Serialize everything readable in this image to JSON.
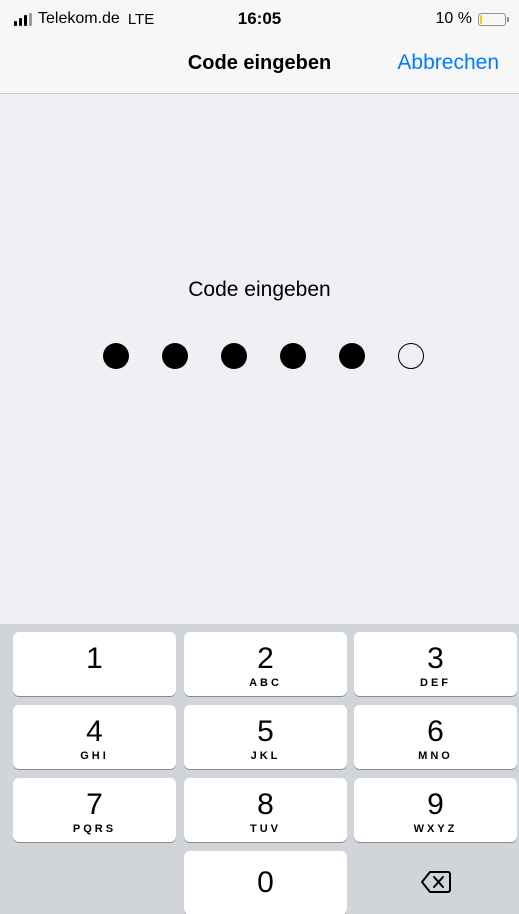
{
  "status_bar": {
    "carrier": "Telekom.de",
    "network": "LTE",
    "time": "16:05",
    "battery_percent": "10 %",
    "battery_level": 0.1,
    "battery_color": "#ffcc00"
  },
  "nav": {
    "title": "Code eingeben",
    "cancel_label": "Abbrechen",
    "accent_color": "#007aff"
  },
  "passcode": {
    "prompt": "Code eingeben",
    "length": 6,
    "entered": 5
  },
  "keypad": {
    "keys": [
      {
        "digit": "1",
        "letters": ""
      },
      {
        "digit": "2",
        "letters": "ABC"
      },
      {
        "digit": "3",
        "letters": "DEF"
      },
      {
        "digit": "4",
        "letters": "GHI"
      },
      {
        "digit": "5",
        "letters": "JKL"
      },
      {
        "digit": "6",
        "letters": "MNO"
      },
      {
        "digit": "7",
        "letters": "PQRS"
      },
      {
        "digit": "8",
        "letters": "TUV"
      },
      {
        "digit": "9",
        "letters": "WXYZ"
      },
      {
        "digit": "0",
        "letters": ""
      }
    ],
    "delete_icon": "backspace-icon"
  }
}
